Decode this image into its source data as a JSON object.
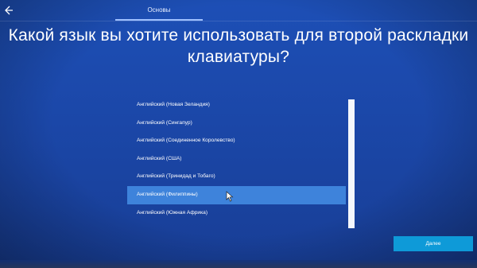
{
  "header": {
    "back_icon": "back-arrow-icon",
    "step_tab": "Основы"
  },
  "title": "Какой язык вы хотите использовать для второй раскладки клавиатуры?",
  "language_list": {
    "items": [
      "Английский (Новая Зеландия)",
      "Английский (Сингапур)",
      "Английский (Соединенное Королевство)",
      "Английский (США)",
      "Английский (Тринидад и Тобаго)",
      "Английский (Филиппины)",
      "Английский (Южная Африка)"
    ],
    "selected_index": 5
  },
  "next_button": {
    "label": "Далее"
  },
  "colors": {
    "background": "#1b47a8",
    "selection": "#3e83db",
    "button": "#0e9ad8",
    "text": "#ffffff"
  }
}
